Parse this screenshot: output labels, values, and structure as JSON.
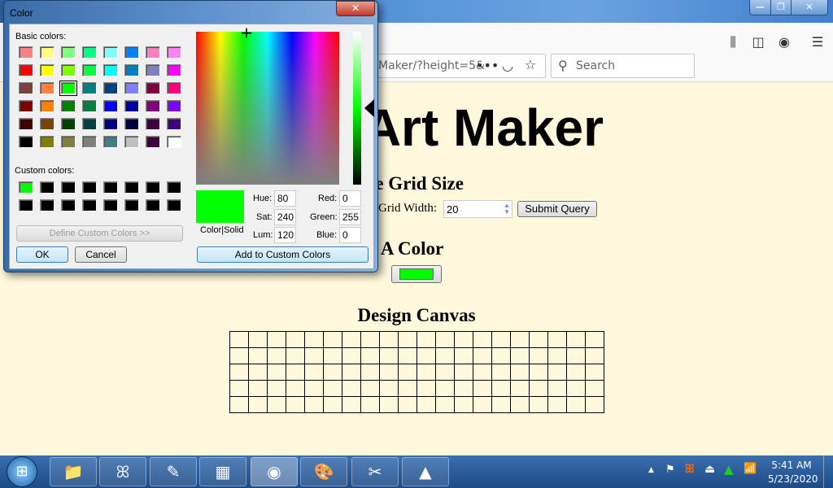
{
  "browser": {
    "url_fragment": "Maker/?height=5&",
    "search_placeholder": "Search",
    "icons": [
      "more-icon",
      "pocket-icon",
      "star-icon",
      "search-icon",
      "library-icon",
      "sidebar-icon",
      "account-icon",
      "menu-icon"
    ]
  },
  "page": {
    "title": "Pixel Art Maker",
    "grid_heading": "Choose Grid Size",
    "width_label": "Grid Width:",
    "width_value": "20",
    "submit_label": "Submit Query",
    "color_heading": "Pick A Color",
    "picked_color": "#00ff00",
    "canvas_heading": "Design Canvas",
    "canvas_rows": 5,
    "canvas_cols": 20
  },
  "dialog": {
    "title": "Color",
    "basic_label": "Basic colors:",
    "custom_label": "Custom colors:",
    "basic_colors": [
      "#FF8080",
      "#FFFF80",
      "#80FF80",
      "#00FF80",
      "#80FFFF",
      "#0080FF",
      "#FF80C0",
      "#FF80FF",
      "#FF0000",
      "#FFFF00",
      "#80FF00",
      "#00FF40",
      "#00FFFF",
      "#0080C0",
      "#8080C0",
      "#FF00FF",
      "#804040",
      "#FF8040",
      "#00FF00",
      "#008080",
      "#004080",
      "#8080FF",
      "#800040",
      "#FF0080",
      "#800000",
      "#FF8000",
      "#008000",
      "#008040",
      "#0000FF",
      "#0000A0",
      "#800080",
      "#8000FF",
      "#400000",
      "#804000",
      "#004000",
      "#004040",
      "#000080",
      "#000040",
      "#400040",
      "#400080",
      "#000000",
      "#808000",
      "#808040",
      "#808080",
      "#408080",
      "#C0C0C0",
      "#400040",
      "#FFFFFF"
    ],
    "selected_basic_index": 18,
    "custom_colors": [
      "#00FF00",
      "#000000",
      "#000000",
      "#000000",
      "#000000",
      "#000000",
      "#000000",
      "#000000",
      "#000000",
      "#000000",
      "#000000",
      "#000000",
      "#000000",
      "#000000",
      "#000000",
      "#000000"
    ],
    "define_custom": "Define Custom Colors >>",
    "ok": "OK",
    "cancel": "Cancel",
    "preview_label": "Color|Solid",
    "hue_label": "Hue:",
    "hue": "80",
    "sat_label": "Sat:",
    "sat": "240",
    "lum_label": "Lum:",
    "lum": "120",
    "red_label": "Red:",
    "red": "0",
    "green_label": "Green:",
    "green": "255",
    "blue_label": "Blue:",
    "blue": "0",
    "add_custom": "Add to Custom Colors",
    "current_color": "#00FF00"
  },
  "taskbar": {
    "apps": [
      "file-explorer-icon",
      "xampp-icon",
      "notepad-plus-plus-icon",
      "calculator-icon",
      "firefox-icon",
      "paint-icon",
      "snipping-tool-icon",
      "sublime-icon"
    ],
    "time": "5:41 AM",
    "date": "5/23/2020"
  }
}
